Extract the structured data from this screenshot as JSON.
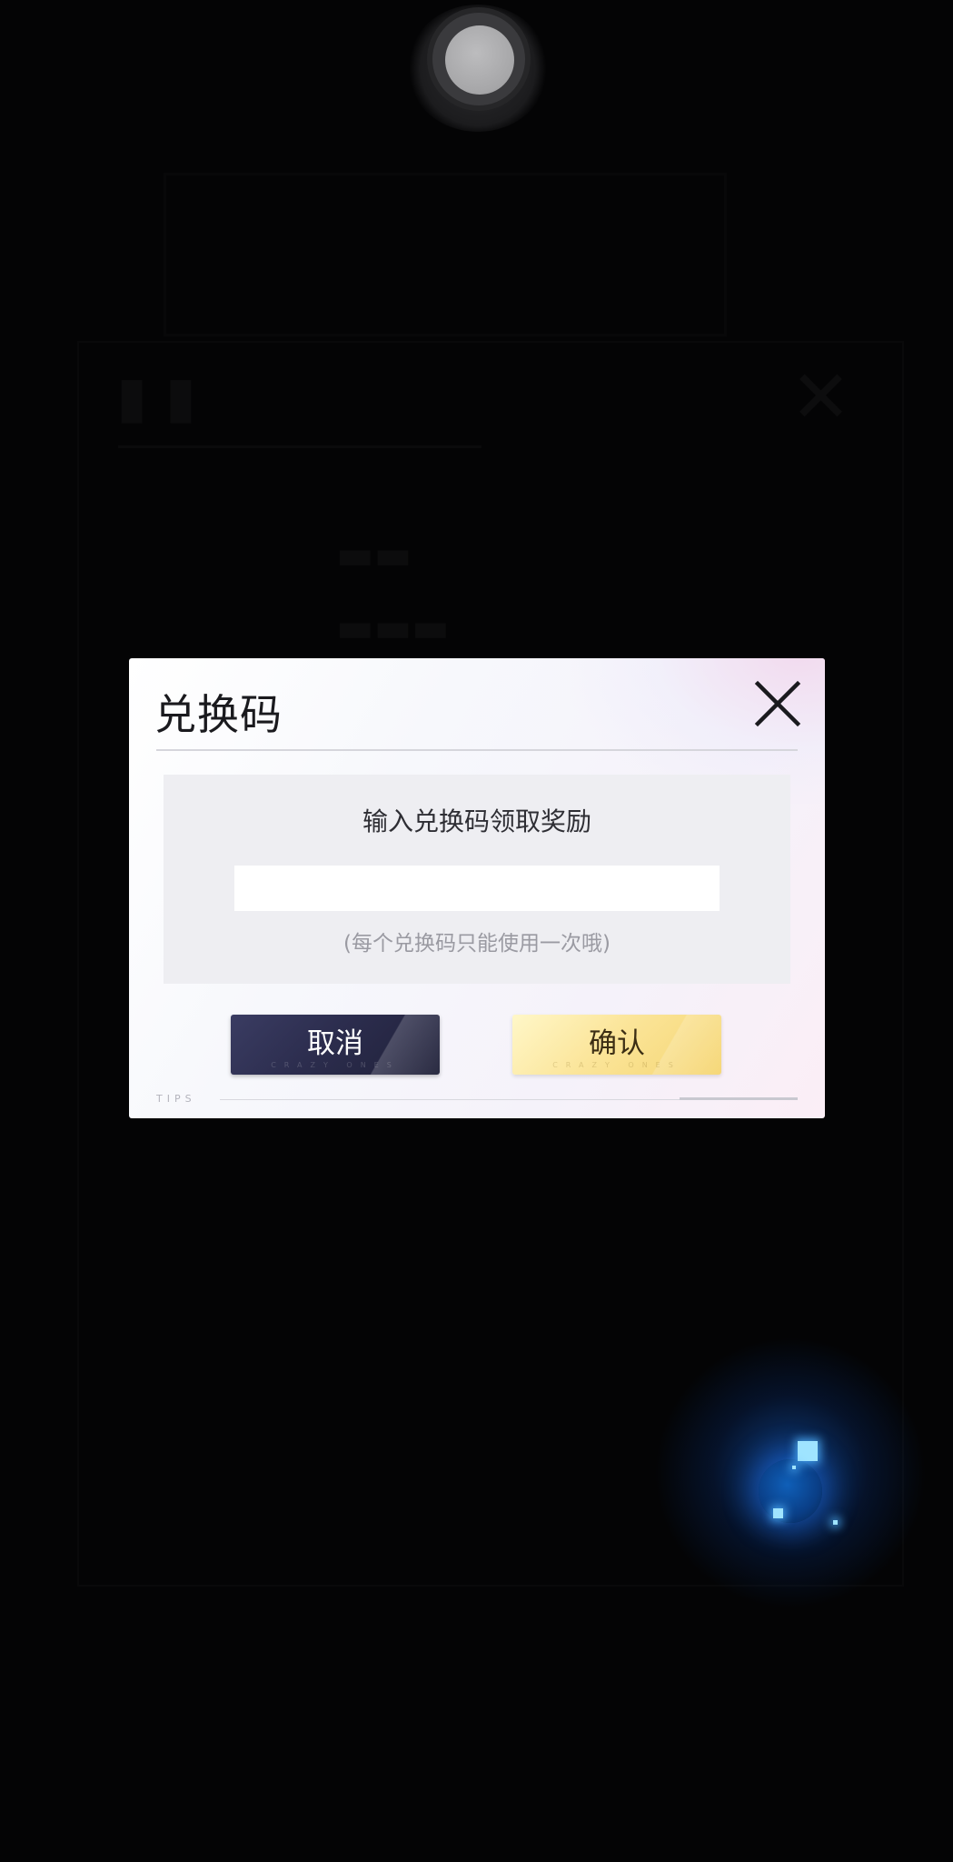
{
  "dialog": {
    "title": "兑换码",
    "prompt": "输入兑换码领取奖励",
    "input": {
      "value": "",
      "placeholder": ""
    },
    "note": "(每个兑换码只能使用一次哦)",
    "cancel_label": "取消",
    "confirm_label": "确认",
    "button_subtext": "CRAZY ONES",
    "tips_label": "TIPS",
    "close_icon": "close-icon"
  },
  "home_button": {
    "icon": "home-button-icon"
  },
  "assistive_orb": {
    "icon": "floating-orb-icon",
    "color": "#1e78ff"
  },
  "colors": {
    "background": "#040405",
    "dialog_bg": "#f7f8fc",
    "cancel_button": "#2c2d4e",
    "confirm_button": "#fbe59a"
  }
}
